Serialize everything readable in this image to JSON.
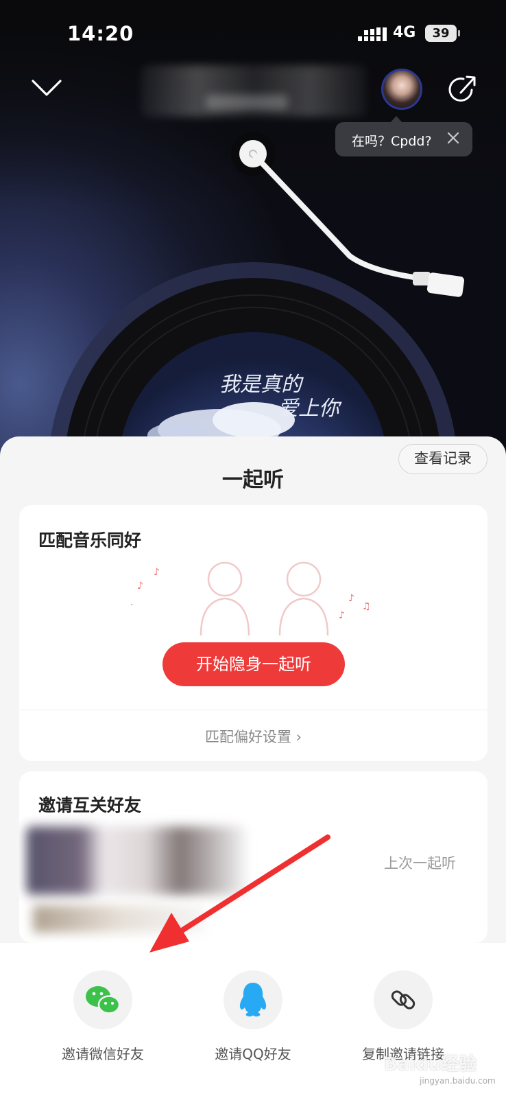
{
  "status_bar": {
    "time": "14:20",
    "network": "4G",
    "battery": "39"
  },
  "tooltip": {
    "text": "在吗？Cpdd?"
  },
  "sheet": {
    "title": "一起听",
    "history_button": "查看记录"
  },
  "match_card": {
    "title": "匹配音乐同好",
    "start_button": "开始隐身一起听",
    "preference_link": "匹配偏好设置"
  },
  "invite_card": {
    "title": "邀请互关好友",
    "last_listen_label": "上次一起听"
  },
  "share_bar": {
    "items": [
      {
        "label": "邀请微信好友",
        "icon": "wechat-icon"
      },
      {
        "label": "邀请QQ好友",
        "icon": "qq-icon"
      },
      {
        "label": "复制邀请链接",
        "icon": "link-icon"
      }
    ]
  },
  "album_art": {
    "text": "我是真的 爱上你"
  },
  "watermark": {
    "text": "Baidu经验",
    "sub": "jingyan.baidu.com"
  },
  "colors": {
    "accent_red": "#ef3a3a",
    "wechat_green": "#3cc24b",
    "qq_blue": "#27a9f3"
  }
}
